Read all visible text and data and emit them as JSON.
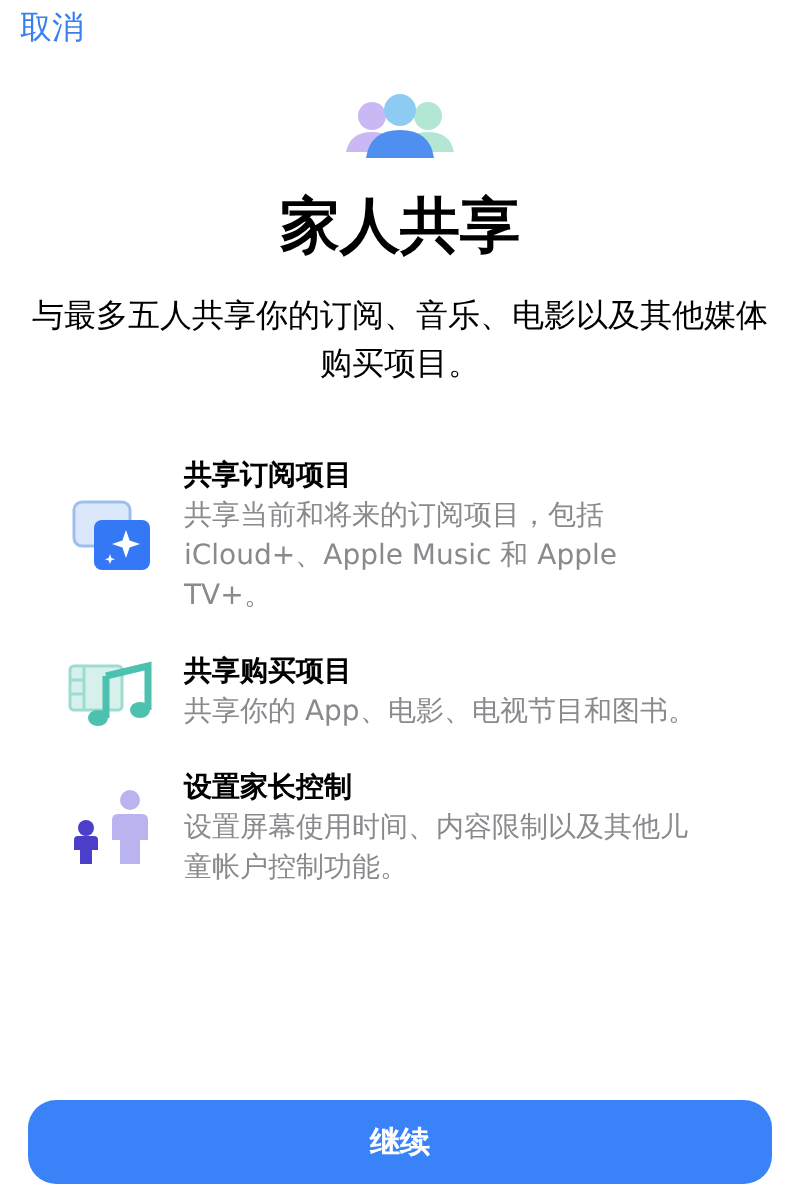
{
  "cancel": "取消",
  "title": "家人共享",
  "subtitle": "与最多五人共享你的订阅、音乐、电影以及其他媒体购买项目。",
  "features": [
    {
      "kind": "subscriptions",
      "title": "共享订阅项目",
      "description": "共享当前和将来的订阅项目，包括 iCloud+、Apple Music 和 Apple TV+。"
    },
    {
      "kind": "purchases",
      "title": "共享购买项目",
      "description": "共享你的 App、电影、电视节目和图书。"
    },
    {
      "kind": "parental",
      "title": "设置家长控制",
      "description": "设置屏幕使用时间、内容限制以及其他儿童帐户控制功能。"
    }
  ],
  "continue_button": "继续"
}
